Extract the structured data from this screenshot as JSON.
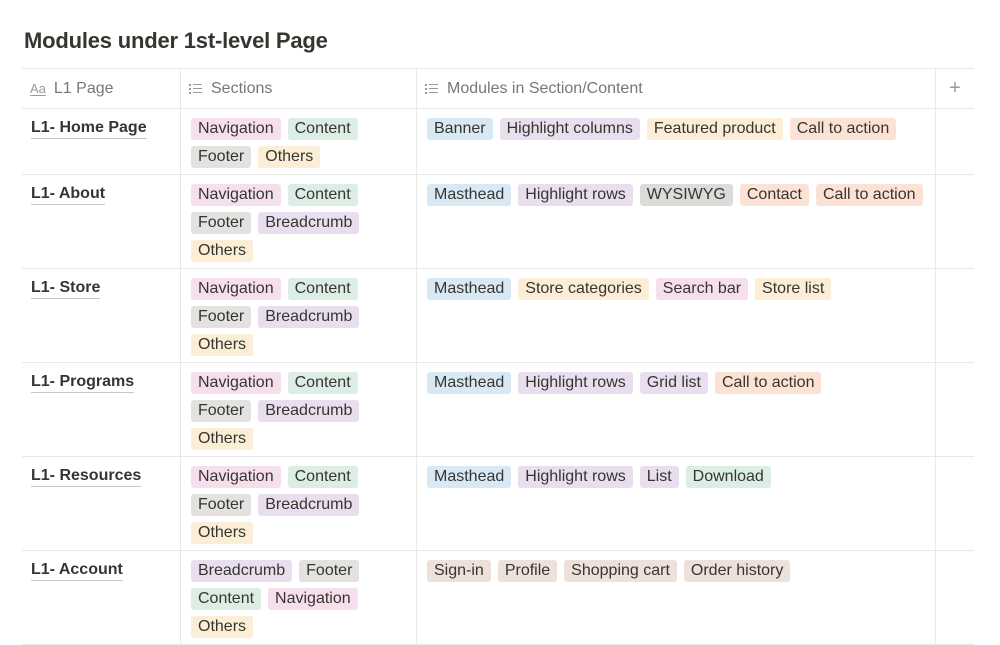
{
  "page": {
    "title": "Modules under 1st-level Page"
  },
  "table": {
    "columns": [
      {
        "label": "L1 Page",
        "icon": "text-property-icon"
      },
      {
        "label": "Sections",
        "icon": "list-property-icon"
      },
      {
        "label": "Modules in Section/Content",
        "icon": "list-property-icon"
      },
      {
        "label": "+",
        "icon": "add-property-icon"
      }
    ],
    "rows": [
      {
        "name": "L1- Home Page",
        "sections": [
          {
            "label": "Navigation",
            "color": "pink"
          },
          {
            "label": "Content",
            "color": "green"
          },
          {
            "label": "Footer",
            "color": "gray"
          },
          {
            "label": "Others",
            "color": "yellow"
          }
        ],
        "modules": [
          {
            "label": "Banner",
            "color": "blue"
          },
          {
            "label": "Highlight columns",
            "color": "purple"
          },
          {
            "label": "Featured product",
            "color": "yellow"
          },
          {
            "label": "Call to action",
            "color": "orange"
          }
        ]
      },
      {
        "name": "L1- About",
        "sections": [
          {
            "label": "Navigation",
            "color": "pink"
          },
          {
            "label": "Content",
            "color": "green"
          },
          {
            "label": "Footer",
            "color": "gray"
          },
          {
            "label": "Breadcrumb",
            "color": "purple"
          },
          {
            "label": "Others",
            "color": "yellow"
          }
        ],
        "modules": [
          {
            "label": "Masthead",
            "color": "blue"
          },
          {
            "label": "Highlight rows",
            "color": "purple"
          },
          {
            "label": "WYSIWYG",
            "color": "darkgray"
          },
          {
            "label": "Contact",
            "color": "orange"
          },
          {
            "label": "Call to action",
            "color": "orange"
          }
        ]
      },
      {
        "name": "L1- Store",
        "sections": [
          {
            "label": "Navigation",
            "color": "pink"
          },
          {
            "label": "Content",
            "color": "green"
          },
          {
            "label": "Footer",
            "color": "gray"
          },
          {
            "label": "Breadcrumb",
            "color": "purple"
          },
          {
            "label": "Others",
            "color": "yellow"
          }
        ],
        "modules": [
          {
            "label": "Masthead",
            "color": "blue"
          },
          {
            "label": "Store categories",
            "color": "yellow"
          },
          {
            "label": "Search bar",
            "color": "pink"
          },
          {
            "label": "Store list",
            "color": "yellow"
          }
        ]
      },
      {
        "name": "L1- Programs",
        "sections": [
          {
            "label": "Navigation",
            "color": "pink"
          },
          {
            "label": "Content",
            "color": "green"
          },
          {
            "label": "Footer",
            "color": "gray"
          },
          {
            "label": "Breadcrumb",
            "color": "purple"
          },
          {
            "label": "Others",
            "color": "yellow"
          }
        ],
        "modules": [
          {
            "label": "Masthead",
            "color": "blue"
          },
          {
            "label": "Highlight rows",
            "color": "purple"
          },
          {
            "label": "Grid list",
            "color": "purple"
          },
          {
            "label": "Call to action",
            "color": "orange"
          }
        ]
      },
      {
        "name": "L1- Resources",
        "sections": [
          {
            "label": "Navigation",
            "color": "pink"
          },
          {
            "label": "Content",
            "color": "green"
          },
          {
            "label": "Footer",
            "color": "gray"
          },
          {
            "label": "Breadcrumb",
            "color": "purple"
          },
          {
            "label": "Others",
            "color": "yellow"
          }
        ],
        "modules": [
          {
            "label": "Masthead",
            "color": "blue"
          },
          {
            "label": "Highlight rows",
            "color": "purple"
          },
          {
            "label": "List",
            "color": "purple"
          },
          {
            "label": "Download",
            "color": "green"
          }
        ]
      },
      {
        "name": "L1- Account",
        "sections": [
          {
            "label": "Breadcrumb",
            "color": "purple"
          },
          {
            "label": "Footer",
            "color": "gray"
          },
          {
            "label": "Content",
            "color": "green"
          },
          {
            "label": "Navigation",
            "color": "pink"
          },
          {
            "label": "Others",
            "color": "yellow"
          }
        ],
        "modules": [
          {
            "label": "Sign-in",
            "color": "brown"
          },
          {
            "label": "Profile",
            "color": "brown"
          },
          {
            "label": "Shopping cart",
            "color": "brown"
          },
          {
            "label": "Order history",
            "color": "brown"
          }
        ]
      }
    ]
  }
}
